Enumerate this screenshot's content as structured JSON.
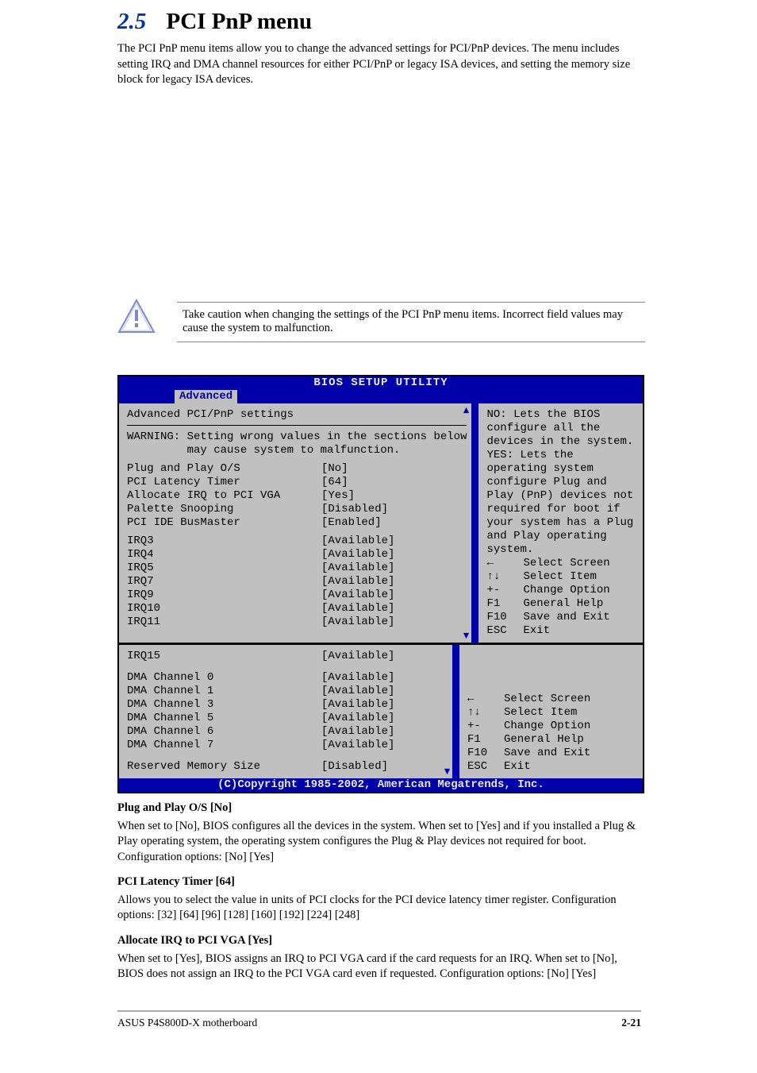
{
  "section": {
    "number": "2.5",
    "title": "PCI PnP menu",
    "intro": "The PCI PnP menu items allow you to change the advanced settings for PCI/PnP devices. The menu includes setting IRQ and DMA channel resources for either PCI/PnP or legacy ISA devices, and setting the memory size block for legacy ISA devices."
  },
  "caution": "Take caution when changing the settings of the PCI PnP menu items. Incorrect field values may cause the system to malfunction.",
  "bios1": {
    "title": "BIOS SETUP UTILITY",
    "tab": "Advanced",
    "subhead": "Advanced PCI/PnP settings",
    "warning_l1": "WARNING: Setting wrong values in the sections below",
    "warning_l2": "         may cause system to malfunction.",
    "rows": [
      {
        "label": "Plug and Play O/S",
        "value": "[No]"
      },
      {
        "label": "PCI Latency Timer",
        "value": "[64]"
      },
      {
        "label": "Allocate IRQ to PCI VGA",
        "value": "[Yes]"
      },
      {
        "label": "Palette Snooping",
        "value": "[Disabled]"
      },
      {
        "label": "PCI IDE BusMaster",
        "value": "[Enabled]"
      }
    ],
    "irq": [
      {
        "label": "IRQ3",
        "value": "[Available]"
      },
      {
        "label": "IRQ4",
        "value": "[Available]"
      },
      {
        "label": "IRQ5",
        "value": "[Available]"
      },
      {
        "label": "IRQ7",
        "value": "[Available]"
      },
      {
        "label": "IRQ9",
        "value": "[Available]"
      },
      {
        "label": "IRQ10",
        "value": "[Available]"
      },
      {
        "label": "IRQ11",
        "value": "[Available]"
      }
    ],
    "help": "NO: Lets the BIOS configure all the devices in the system. YES: Lets the operating system configure Plug and Play (PnP) devices not required for boot if your system has a Plug and Play operating system.",
    "nav": [
      {
        "key": "←",
        "label": "Select Screen"
      },
      {
        "key": "↑↓",
        "label": "Select Item"
      },
      {
        "key": "+-",
        "label": "Change Option"
      },
      {
        "key": "F1",
        "label": "General Help"
      },
      {
        "key": "F10",
        "label": "Save and Exit"
      },
      {
        "key": "ESC",
        "label": "Exit"
      }
    ],
    "copyright": "(C)Copyright 1985-2002, American Megatrends, Inc."
  },
  "bios2": {
    "rows": [
      {
        "label": "IRQ15",
        "value": "[Available]"
      }
    ],
    "dma": [
      {
        "label": "DMA Channel 0",
        "value": "[Available]"
      },
      {
        "label": "DMA Channel 1",
        "value": "[Available]"
      },
      {
        "label": "DMA Channel 3",
        "value": "[Available]"
      },
      {
        "label": "DMA Channel 5",
        "value": "[Available]"
      },
      {
        "label": "DMA Channel 6",
        "value": "[Available]"
      },
      {
        "label": "DMA Channel 7",
        "value": "[Available]"
      }
    ],
    "reserved": {
      "label": "Reserved Memory Size",
      "value": "[Disabled]"
    },
    "nav": [
      {
        "key": "←",
        "label": "Select Screen"
      },
      {
        "key": "↑↓",
        "label": "Select Item"
      },
      {
        "key": "+-",
        "label": "Change Option"
      },
      {
        "key": "F1",
        "label": "General Help"
      },
      {
        "key": "F10",
        "label": "Save and Exit"
      },
      {
        "key": "ESC",
        "label": "Exit"
      }
    ],
    "copyright": "(C)Copyright 1985-2002, American Megatrends, Inc."
  },
  "lower": {
    "h1": "Plug and Play O/S [No]",
    "p1": "When set to [No], BIOS configures all the devices in the system. When set to [Yes] and if you installed a Plug & Play operating system, the operating system configures the Plug & Play devices not required for boot. Configuration options: [No] [Yes]",
    "h2": "PCI Latency Timer [64]",
    "p2": "Allows you to select the value in units of PCI clocks for the PCI device latency timer register. Configuration options: [32] [64] [96] [128] [160] [192] [224] [248]",
    "h3": "Allocate IRQ to PCI VGA [Yes]",
    "p3": "When set to [Yes], BIOS assigns an IRQ to PCI VGA card if the card requests for an IRQ. When set to [No], BIOS does not assign an IRQ to the PCI VGA card even if requested. Configuration options: [No] [Yes]"
  },
  "footer": {
    "left": "ASUS P4S800D-X motherboard",
    "right": "2-21"
  }
}
